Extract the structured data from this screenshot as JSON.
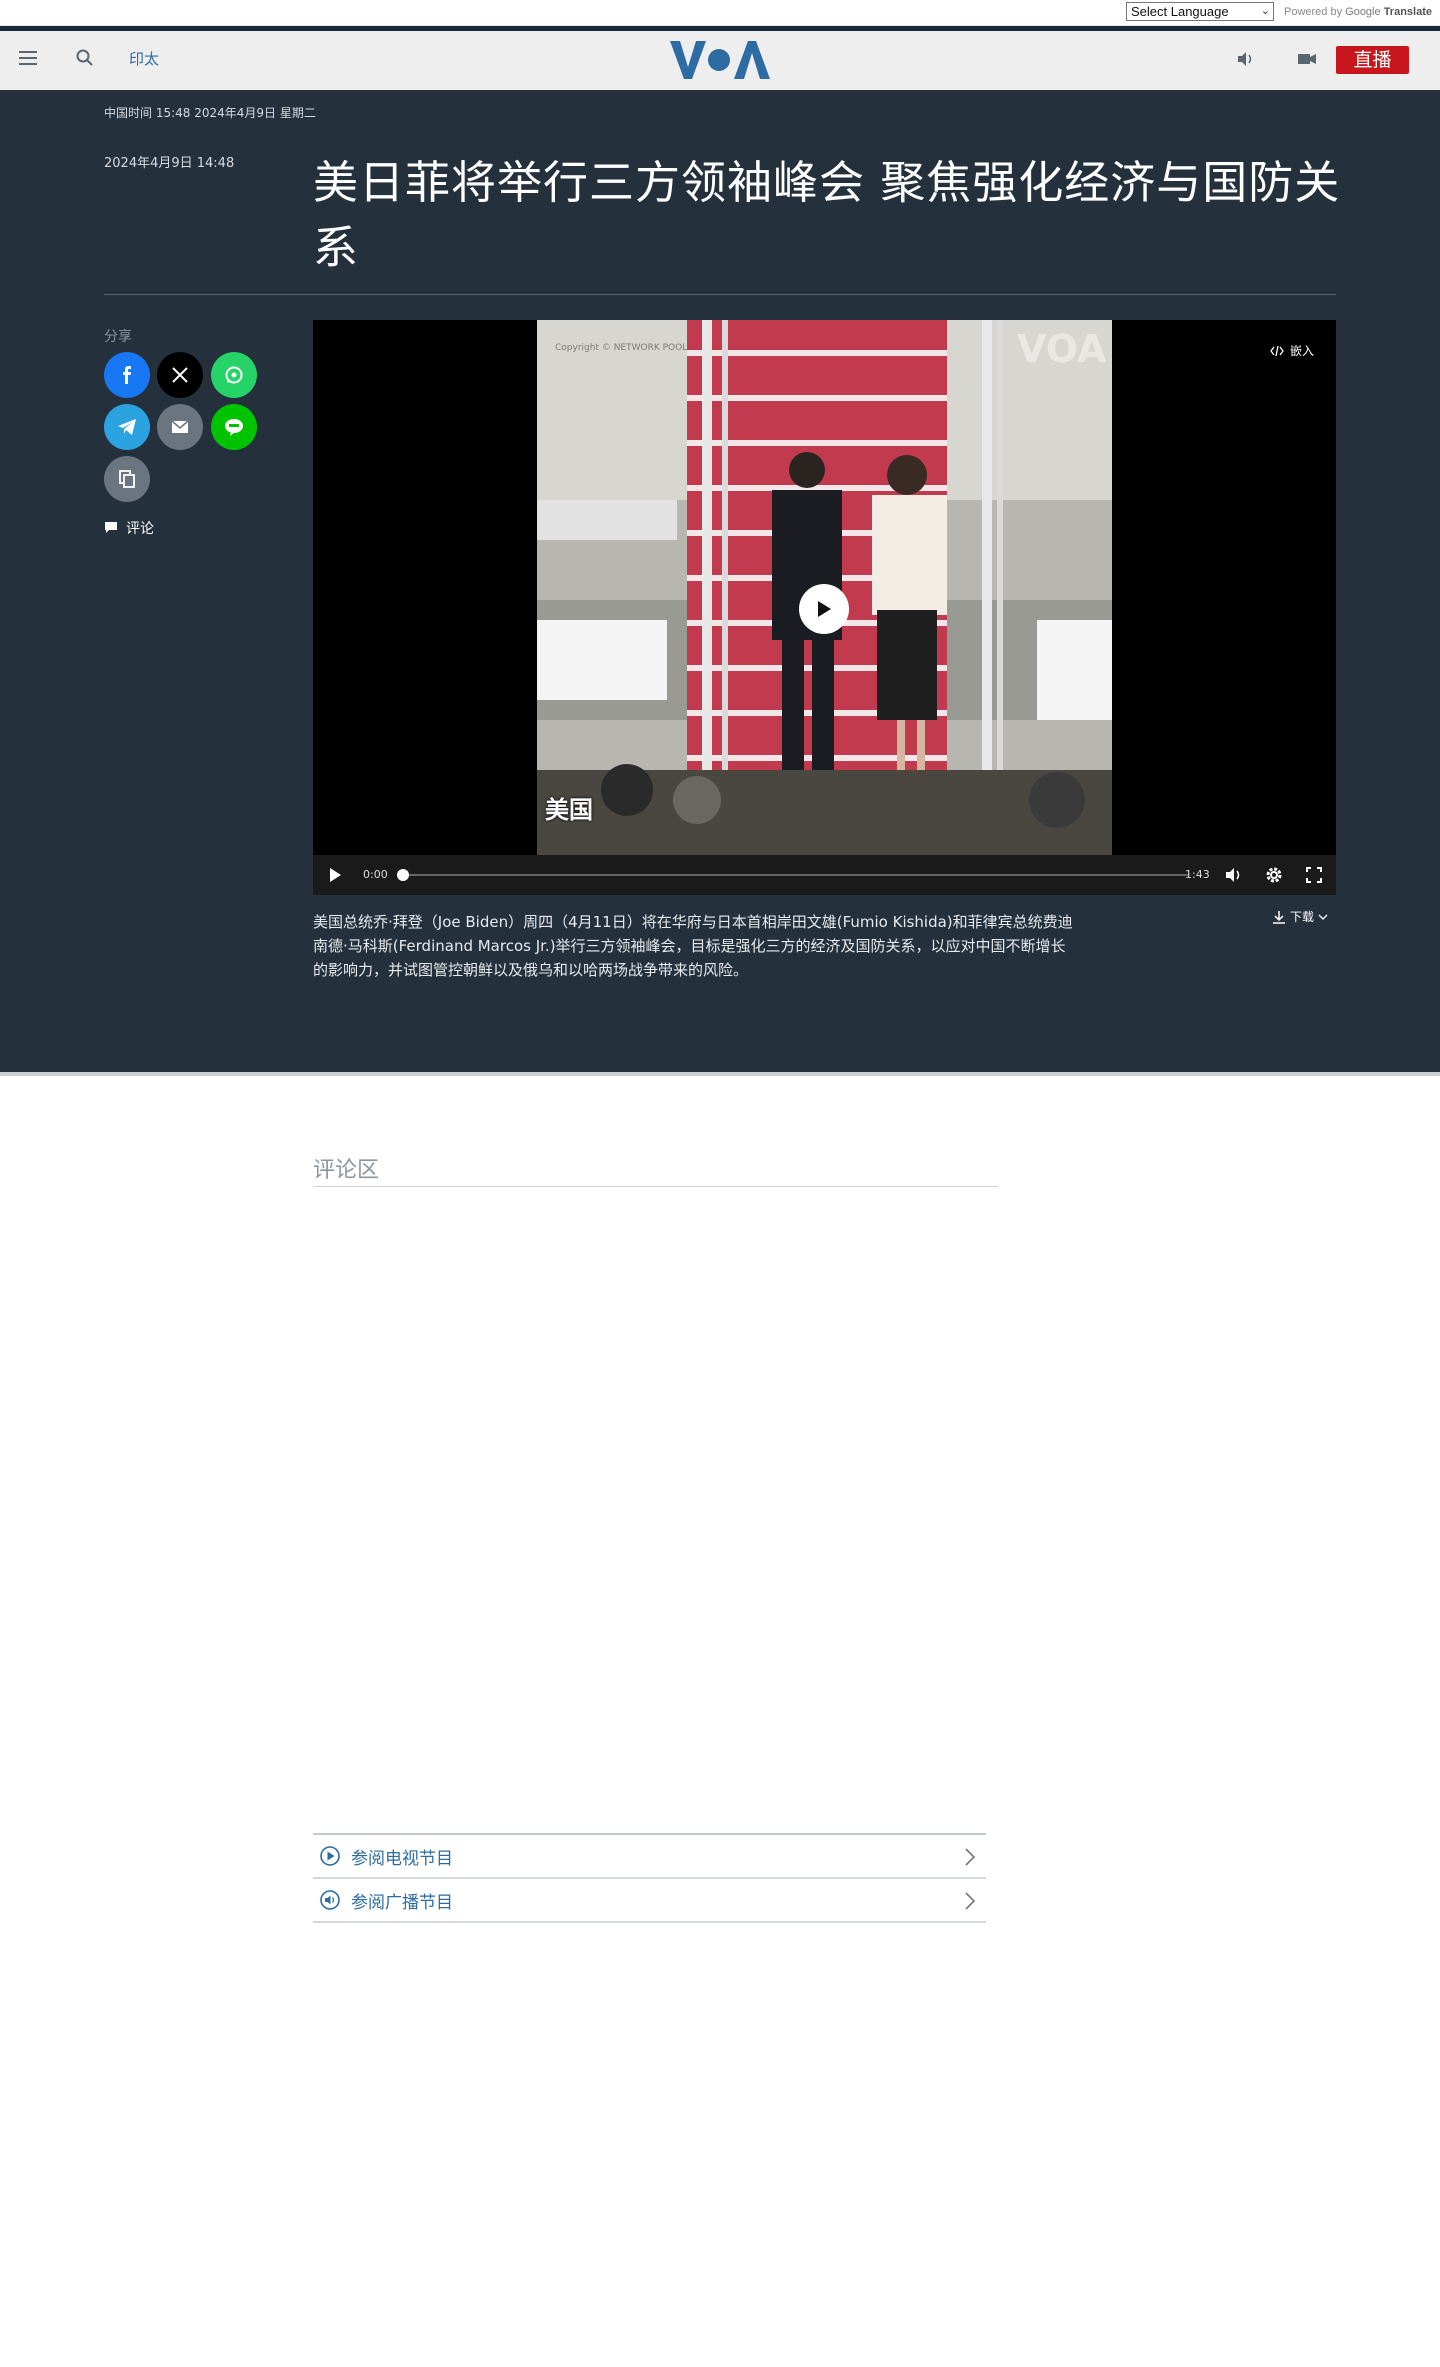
{
  "translate": {
    "select_label": "Select Language",
    "powered_by": "Powered by",
    "google": "Google",
    "translate": "Translate"
  },
  "header": {
    "section": "印太",
    "logo_text": "VOA",
    "live_label": "直播",
    "brand_color": "#2d6ca2",
    "live_color": "#c8161d"
  },
  "article": {
    "timestamp": "中国时间 15:48 2024年4月9日 星期二",
    "published": "2024年4月9日 14:48",
    "headline": "美日菲将举行三方领袖峰会 聚焦强化经济与国防关系",
    "share_label": "分享",
    "share_buttons": [
      {
        "name": "facebook",
        "color": "#1877f2"
      },
      {
        "name": "x",
        "color": "#000000"
      },
      {
        "name": "whatsapp",
        "color": "#25d366"
      },
      {
        "name": "telegram",
        "color": "#2aa3e0"
      },
      {
        "name": "email",
        "color": "#6b7580"
      },
      {
        "name": "line",
        "color": "#00c300"
      },
      {
        "name": "copy-link",
        "color": "#6b7580"
      }
    ],
    "comment_label": "评论"
  },
  "video": {
    "embed_label": "嵌入",
    "overlay_text": "美国",
    "current_time": "0:00",
    "duration": "1:43",
    "progress": 0,
    "download_label": "下载"
  },
  "caption": "美国总统乔·拜登（Joe Biden）周四（4月11日）将在华府与日本首相岸田文雄(Fumio Kishida)和菲律宾总统费迪南德·马科斯(Ferdinand Marcos Jr.)举行三方领袖峰会，目标是强化三方的经济及国防关系，以应对中国不断增长的影响力，并试图管控朝鲜以及俄乌和以哈两场战争带来的风险。",
  "comments": {
    "title": "评论区"
  },
  "programs": [
    {
      "label": "参阅电视节目",
      "icon": "play-circle-icon"
    },
    {
      "label": "参阅广播节目",
      "icon": "audio-circle-icon"
    }
  ]
}
